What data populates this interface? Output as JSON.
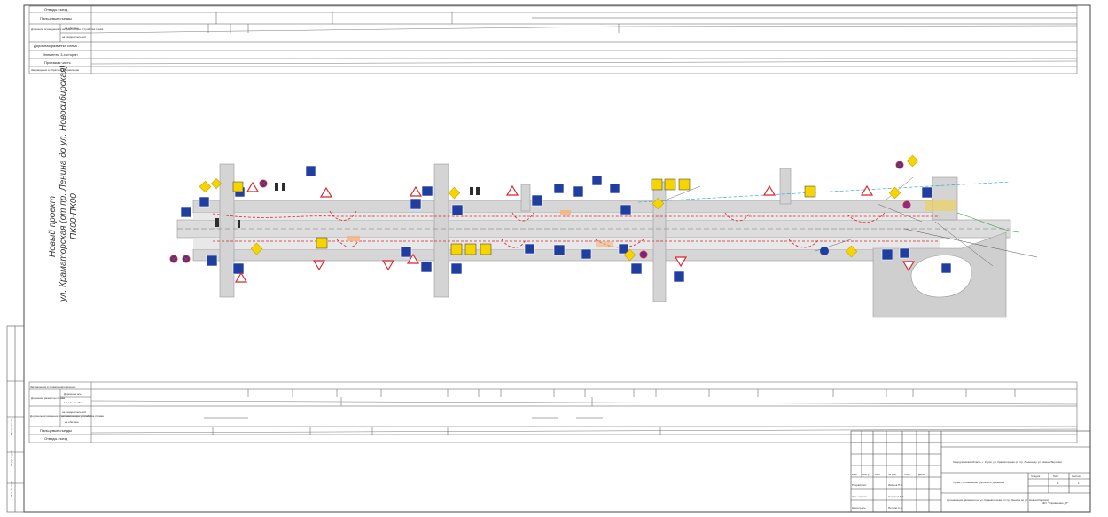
{
  "drawing": {
    "title_lines": [
      "Новый проект",
      "ул. Краматорская (от пр. Ленина до ул. Новосибирская)",
      "ПК00-ПК00"
    ]
  },
  "top_table": {
    "rows": [
      "Отводы съезд",
      "Пальцевые съезды",
      "Дорожное ограждение и направляющие устройства слева",
      "Дорожная разметка слева",
      "Элементы 3-х сторон",
      "Проезжая часть",
      "Заграждение в обратном направлении"
    ],
    "sub_rows": [
      "на обочине",
      "на разделительной"
    ]
  },
  "bottom_table": {
    "rows": [
      "Заграждение в прямом направлении",
      "Дорожная разметка справа",
      "Дорожное ограждение и направляющие устройства справа",
      "Пальцевые съезды",
      "Отводы съезд"
    ],
    "sub_rows": [
      "Дорожная ось",
      "1-я ось по обоч.",
      "на разделительной",
      "на обочине"
    ]
  },
  "title_block": {
    "org": "Свердловская область, г. Курск, ул. Краматорская (от пр. Ленина до ул. Новосибирская)",
    "project": "Проект организации дорожного движения",
    "sheet_title": "Организация движения на ул. Краматорская (от пр. Ленина до ул. Новосибирская)",
    "company": "МКУ \"Управление ДТ\"",
    "stage_label": "Стадия",
    "sheet_label": "Лист",
    "sheets_label": "Листов",
    "stage": "",
    "sheet": "1",
    "sheets": "1",
    "col_headers": [
      "Изм.",
      "Кол.уч",
      "Лист",
      "№ док.",
      "Подп.",
      "Дата"
    ],
    "roles": [
      "Разработал",
      "Нач. отдела",
      "Н.контроль"
    ],
    "names": [
      "Иванов П.Р.",
      "Сидоров В.Г.",
      "Петров А.А."
    ]
  },
  "stamp": {
    "labels": [
      "Инв. № подл.",
      "Подп. и дата",
      "Взам. инв. №"
    ]
  },
  "colors": {
    "road": "#d8d8d8",
    "road_edge": "#9a9a9a",
    "markup_red": "#d8262e",
    "sign_blue": "#1f3ea0",
    "sign_yellow": "#f5d400",
    "lines": "#555555",
    "cyan": "#21a3c8"
  }
}
